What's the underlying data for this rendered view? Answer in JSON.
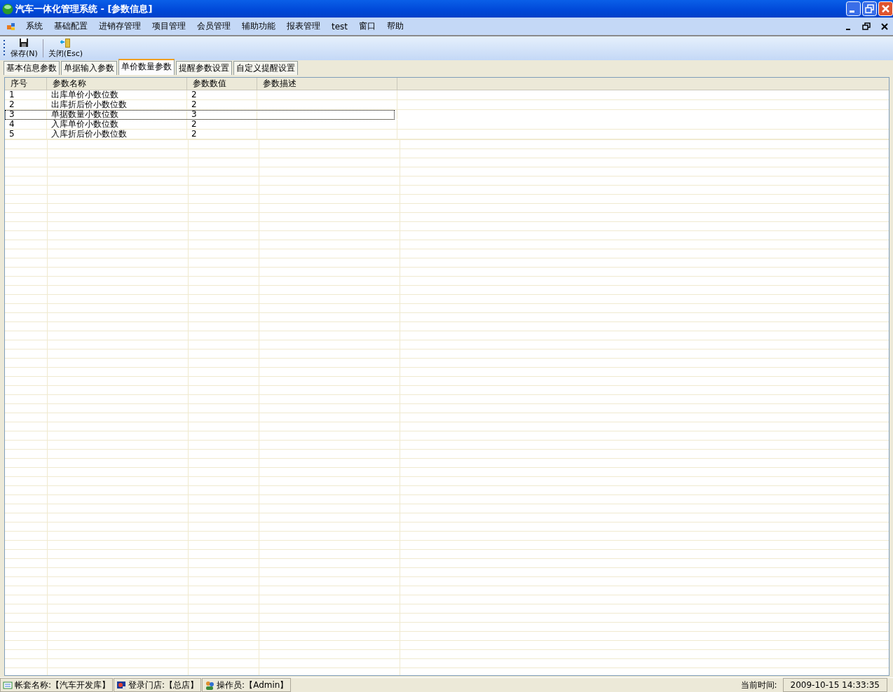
{
  "window": {
    "title": "汽车一体化管理系统 - [参数信息]"
  },
  "menu": [
    "系统",
    "基础配置",
    "进销存管理",
    "项目管理",
    "会员管理",
    "辅助功能",
    "报表管理",
    "test",
    "窗口",
    "帮助"
  ],
  "toolbar": [
    {
      "kind": "save",
      "label": "保存(N)"
    },
    {
      "kind": "close",
      "label": "关闭(Esc)"
    }
  ],
  "tabs": [
    {
      "label": "基本信息参数",
      "selected": false
    },
    {
      "label": "单据输入参数",
      "selected": false
    },
    {
      "label": "单价数量参数",
      "selected": true
    },
    {
      "label": "提醒参数设置",
      "selected": false
    },
    {
      "label": "自定义提醒设置",
      "selected": false
    }
  ],
  "table": {
    "columns": [
      "序号",
      "参数名称",
      "参数数值",
      "参数描述"
    ],
    "rows": [
      {
        "cells": [
          "1",
          "出库单价小数位数",
          "2"
        ],
        "selected": false
      },
      {
        "cells": [
          "2",
          "出库折后价小数位数",
          "2"
        ],
        "selected": false
      },
      {
        "cells": [
          "3",
          "单据数量小数位数",
          "3"
        ],
        "selected": true
      },
      {
        "cells": [
          "4",
          "入库单价小数位数",
          "2"
        ],
        "selected": false
      },
      {
        "cells": [
          "5",
          "入库折后价小数位数",
          "2"
        ],
        "selected": false
      }
    ]
  },
  "status_bar": {
    "panels": [
      {
        "kind": "book",
        "text": "帐套名称:【汽车开发库】"
      },
      {
        "kind": "store",
        "text": "登录门店:【总店】"
      },
      {
        "kind": "users",
        "text": "操作员:【Admin】"
      }
    ],
    "time_label": "当前时间:",
    "time": "2009-10-15 14:33:35"
  }
}
